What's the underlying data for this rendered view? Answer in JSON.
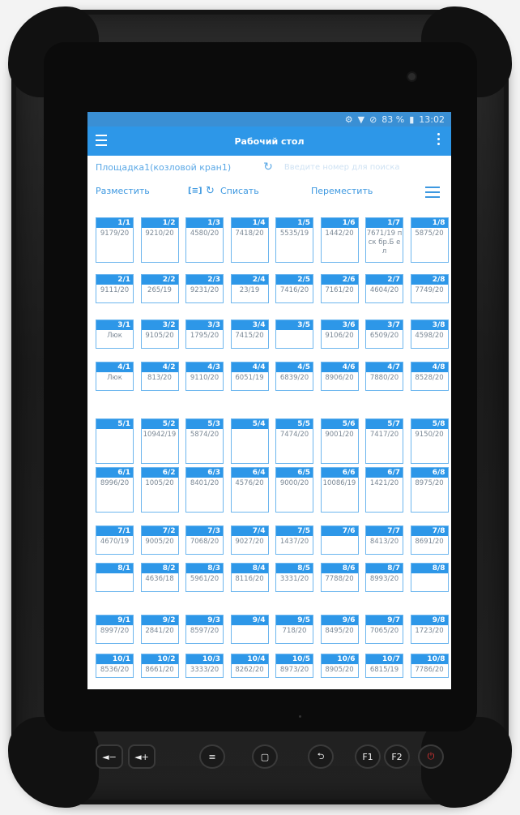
{
  "status_bar": {
    "icons": [
      "settings-icon",
      "wifi-icon",
      "no-sim-icon",
      "battery-icon"
    ],
    "battery": "83 %",
    "time": "13:02"
  },
  "toolbar": {
    "title": "Рабочий стол"
  },
  "filters": {
    "site": "Площадка1(козловой кран1)",
    "search_placeholder": "Введите номер для поиска"
  },
  "actions": {
    "place": "Разместить",
    "scan": "[≡]",
    "write_off": "Списать",
    "move": "Переместить"
  },
  "rows": [
    {
      "cells": [
        {
          "id": "1/1",
          "value": "9179/20"
        },
        {
          "id": "1/2",
          "value": "9210/20"
        },
        {
          "id": "1/3",
          "value": "4580/20"
        },
        {
          "id": "1/4",
          "value": "7418/20"
        },
        {
          "id": "1/5",
          "value": "5535/19"
        },
        {
          "id": "1/6",
          "value": "1442/20"
        },
        {
          "id": "1/7",
          "value": "7671/19 пск бр.Б ел"
        },
        {
          "id": "1/8",
          "value": "5875/20"
        }
      ]
    },
    {
      "cells": [
        {
          "id": "2/1",
          "value": "9111/20"
        },
        {
          "id": "2/2",
          "value": "265/19"
        },
        {
          "id": "2/3",
          "value": "9231/20"
        },
        {
          "id": "2/4",
          "value": "23/19"
        },
        {
          "id": "2/5",
          "value": "7416/20"
        },
        {
          "id": "2/6",
          "value": "7161/20"
        },
        {
          "id": "2/7",
          "value": "4604/20"
        },
        {
          "id": "2/8",
          "value": "7749/20"
        }
      ]
    },
    {
      "cells": [
        {
          "id": "3/1",
          "value": "Люк"
        },
        {
          "id": "3/2",
          "value": "9105/20"
        },
        {
          "id": "3/3",
          "value": "1795/20"
        },
        {
          "id": "3/4",
          "value": "7415/20"
        },
        {
          "id": "3/5",
          "value": ""
        },
        {
          "id": "3/6",
          "value": "9106/20"
        },
        {
          "id": "3/7",
          "value": "6509/20"
        },
        {
          "id": "3/8",
          "value": "4598/20"
        }
      ]
    },
    {
      "cells": [
        {
          "id": "4/1",
          "value": "Люк"
        },
        {
          "id": "4/2",
          "value": "813/20"
        },
        {
          "id": "4/3",
          "value": "9110/20"
        },
        {
          "id": "4/4",
          "value": "6051/19"
        },
        {
          "id": "4/5",
          "value": "6839/20"
        },
        {
          "id": "4/6",
          "value": "8906/20"
        },
        {
          "id": "4/7",
          "value": "7880/20"
        },
        {
          "id": "4/8",
          "value": "8528/20"
        }
      ]
    },
    {
      "cells": [
        {
          "id": "5/1",
          "value": ""
        },
        {
          "id": "5/2",
          "value": "10942/19"
        },
        {
          "id": "5/3",
          "value": "5874/20"
        },
        {
          "id": "5/4",
          "value": ""
        },
        {
          "id": "5/5",
          "value": "7474/20"
        },
        {
          "id": "5/6",
          "value": "9001/20"
        },
        {
          "id": "5/7",
          "value": "7417/20"
        },
        {
          "id": "5/8",
          "value": "9150/20"
        }
      ]
    },
    {
      "cells": [
        {
          "id": "6/1",
          "value": "8996/20"
        },
        {
          "id": "6/2",
          "value": "1005/20"
        },
        {
          "id": "6/3",
          "value": "8401/20"
        },
        {
          "id": "6/4",
          "value": "4576/20"
        },
        {
          "id": "6/5",
          "value": "9000/20"
        },
        {
          "id": "6/6",
          "value": "10086/19"
        },
        {
          "id": "6/7",
          "value": "1421/20"
        },
        {
          "id": "6/8",
          "value": "8975/20"
        }
      ]
    },
    {
      "cells": [
        {
          "id": "7/1",
          "value": "4670/19"
        },
        {
          "id": "7/2",
          "value": "9005/20"
        },
        {
          "id": "7/3",
          "value": "7068/20"
        },
        {
          "id": "7/4",
          "value": "9027/20"
        },
        {
          "id": "7/5",
          "value": "1437/20"
        },
        {
          "id": "7/6",
          "value": ""
        },
        {
          "id": "7/7",
          "value": "8413/20"
        },
        {
          "id": "7/8",
          "value": "8691/20"
        }
      ]
    },
    {
      "cells": [
        {
          "id": "8/1",
          "value": ""
        },
        {
          "id": "8/2",
          "value": "4636/18"
        },
        {
          "id": "8/3",
          "value": "5961/20"
        },
        {
          "id": "8/4",
          "value": "8116/20"
        },
        {
          "id": "8/5",
          "value": "3331/20"
        },
        {
          "id": "8/6",
          "value": "7788/20"
        },
        {
          "id": "8/7",
          "value": "8993/20"
        },
        {
          "id": "8/8",
          "value": ""
        }
      ]
    },
    {
      "cells": [
        {
          "id": "9/1",
          "value": "8997/20"
        },
        {
          "id": "9/2",
          "value": "2841/20"
        },
        {
          "id": "9/3",
          "value": "8597/20"
        },
        {
          "id": "9/4",
          "value": ""
        },
        {
          "id": "9/5",
          "value": "718/20"
        },
        {
          "id": "9/6",
          "value": "8495/20"
        },
        {
          "id": "9/7",
          "value": "7065/20"
        },
        {
          "id": "9/8",
          "value": "1723/20"
        }
      ]
    },
    {
      "cells": [
        {
          "id": "10/1",
          "value": "8536/20"
        },
        {
          "id": "10/2",
          "value": "8661/20"
        },
        {
          "id": "10/3",
          "value": "3333/20"
        },
        {
          "id": "10/4",
          "value": "8262/20"
        },
        {
          "id": "10/5",
          "value": "8973/20"
        },
        {
          "id": "10/6",
          "value": "8905/20"
        },
        {
          "id": "10/7",
          "value": "6815/19"
        },
        {
          "id": "10/8",
          "value": "7786/20"
        }
      ]
    }
  ],
  "hardware_buttons": [
    "volume-down-button",
    "volume-up-button",
    "menu-button",
    "home-button",
    "back-button",
    "F1",
    "F2",
    "power-button"
  ],
  "colors": {
    "primary": "#2d97e8",
    "statusbar": "#3a8fd4",
    "cell_border": "#6db6ee",
    "text_muted": "#7a8794"
  }
}
